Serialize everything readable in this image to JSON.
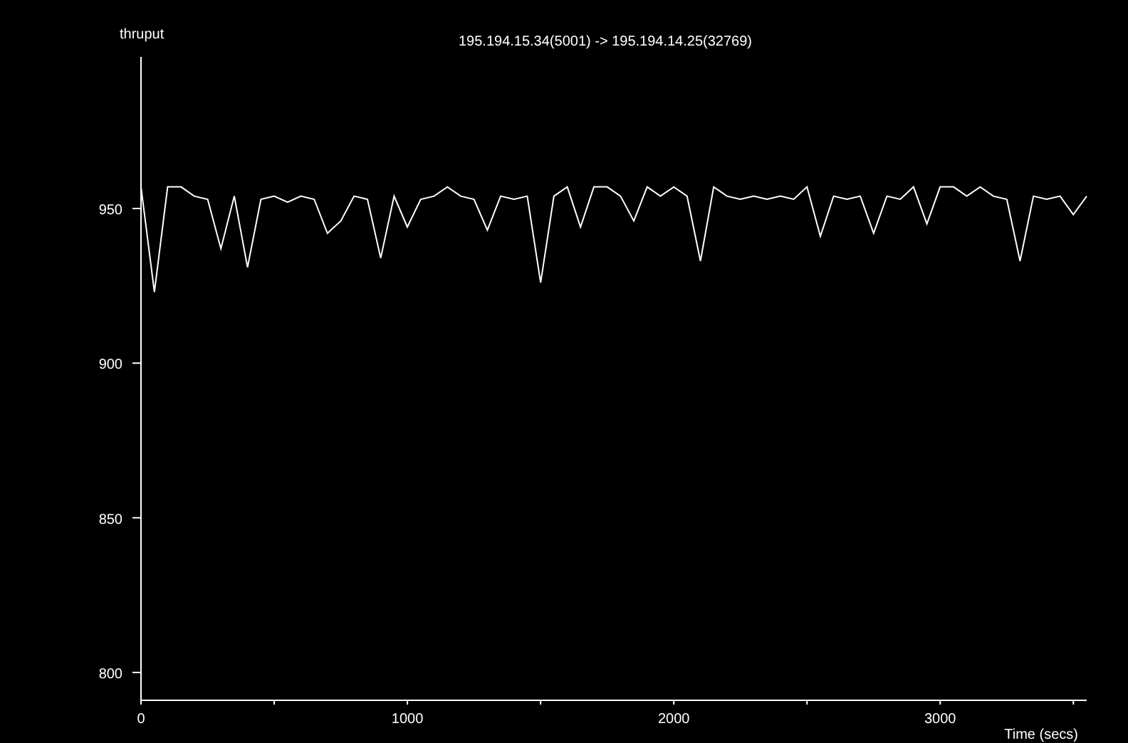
{
  "plot": {
    "chart_data": {
      "type": "line",
      "title": "195.194.15.34(5001) -> 195.194.14.25(32769)",
      "xlabel": "Time (secs)",
      "ylabel": "thruput",
      "xlim": [
        0,
        3550
      ],
      "ylim": [
        791,
        999
      ],
      "xticks": [
        0,
        1000,
        2000,
        3000
      ],
      "yticks": [
        800,
        850,
        900,
        950
      ],
      "x": [
        0,
        50,
        100,
        150,
        200,
        250,
        300,
        350,
        400,
        450,
        500,
        550,
        600,
        650,
        700,
        750,
        800,
        850,
        900,
        950,
        1000,
        1050,
        1100,
        1150,
        1200,
        1250,
        1300,
        1350,
        1400,
        1450,
        1500,
        1550,
        1600,
        1650,
        1700,
        1750,
        1800,
        1850,
        1900,
        1950,
        2000,
        2050,
        2100,
        2150,
        2200,
        2250,
        2300,
        2350,
        2400,
        2450,
        2500,
        2550,
        2600,
        2650,
        2700,
        2750,
        2800,
        2850,
        2900,
        2950,
        3000,
        3050,
        3100,
        3150,
        3200,
        3250,
        3300,
        3350,
        3400,
        3450,
        3500,
        3550
      ],
      "series": [
        {
          "color": "#ffffff",
          "values": [
            957,
            923,
            957,
            957,
            954,
            953,
            937,
            954,
            931,
            953,
            954,
            952,
            954,
            953,
            942,
            946,
            954,
            953,
            934,
            954,
            944,
            953,
            954,
            957,
            954,
            953,
            943,
            954,
            953,
            954,
            926,
            954,
            957,
            944,
            957,
            957,
            954,
            946,
            957,
            954,
            957,
            954,
            933,
            957,
            954,
            953,
            954,
            953,
            954,
            953,
            957,
            941,
            954,
            953,
            954,
            942,
            954,
            953,
            957,
            945,
            957,
            957,
            954,
            957,
            954,
            953,
            933,
            954,
            953,
            954,
            948,
            954
          ]
        }
      ]
    }
  }
}
